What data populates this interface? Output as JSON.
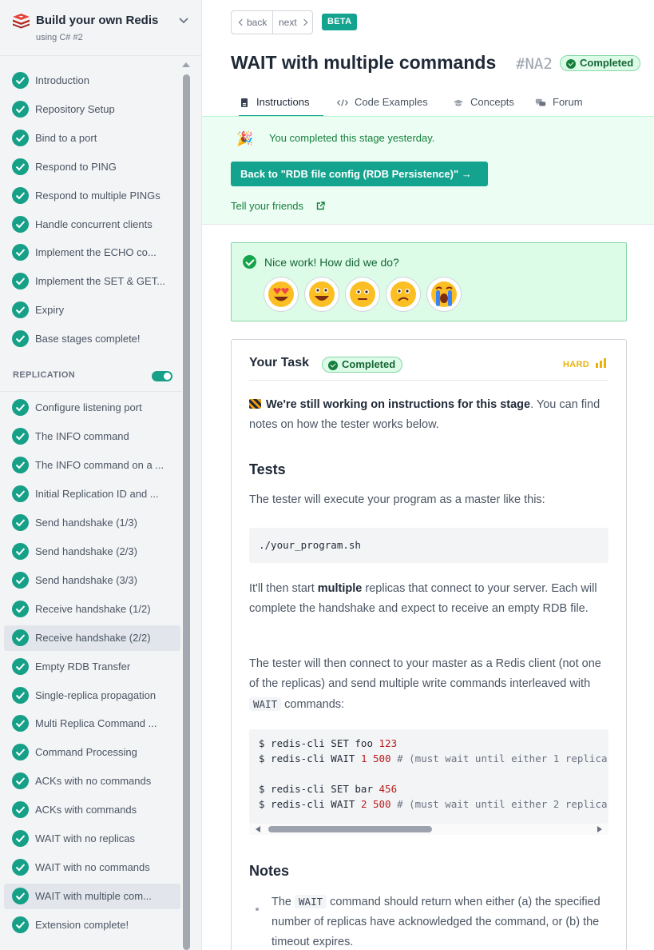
{
  "course": {
    "title": "Build your own Redis",
    "subtitle": "using C# #2"
  },
  "stages_base": [
    "Introduction",
    "Repository Setup",
    "Bind to a port",
    "Respond to PING",
    "Respond to multiple PINGs",
    "Handle concurrent clients",
    "Implement the ECHO co...",
    "Implement the SET & GET...",
    "Expiry",
    "Base stages complete!"
  ],
  "section_label": "REPLICATION",
  "stages_replication": [
    "Configure listening port",
    "The INFO command",
    "The INFO command on a ...",
    "Initial Replication ID and ...",
    "Send handshake (1/3)",
    "Send handshake (2/3)",
    "Send handshake (3/3)",
    "Receive handshake (1/2)",
    "Receive handshake (2/2)",
    "Empty RDB Transfer",
    "Single-replica propagation",
    "Multi Replica Command ...",
    "Command Processing",
    "ACKs with no commands",
    "ACKs with commands",
    "WAIT with no replicas",
    "WAIT with no commands",
    "WAIT with multiple com...",
    "Extension complete!"
  ],
  "nav": {
    "back": "back",
    "next": "next",
    "beta": "BETA"
  },
  "header": {
    "title": "WAIT with multiple commands",
    "code": "#NA2",
    "status": "Completed"
  },
  "tabs": {
    "instructions": "Instructions",
    "code_examples": "Code Examples",
    "concepts": "Concepts",
    "forum": "Forum"
  },
  "congrats": {
    "message": "You completed this stage yesterday.",
    "back_button": "Back to \"RDB file config (RDB Persistence)\" →",
    "tell_friends": "Tell your friends"
  },
  "feedback": {
    "prompt": "Nice work! How did we do?"
  },
  "task": {
    "heading": "Your Task",
    "status": "Completed",
    "difficulty": "HARD",
    "wip_bold": "We're still working on instructions for this stage",
    "wip_rest": ". You can find notes on how the tester works below.",
    "tests_heading": "Tests",
    "tests_p1": "The tester will execute your program as a master like this:",
    "cmd": "./your_program.sh",
    "p2_a": "It'll then start ",
    "p2_b": "multiple",
    "p2_c": " replicas that connect to your server. Each will complete the handshake and expect to receive an empty RDB file.",
    "p3_a": "The tester will then connect to your master as a Redis client (not one of the replicas) and send multiple write commands interleaved with ",
    "p3_code": "WAIT",
    "p3_c": " commands:",
    "code_lines": [
      {
        "prefix": "$ redis-cli SET foo ",
        "num": "123",
        "rest": ""
      },
      {
        "prefix": "$ redis-cli WAIT ",
        "num": "1 500",
        "rest": " # (must wait until either 1 replica"
      },
      {
        "prefix": "",
        "num": "",
        "rest": ""
      },
      {
        "prefix": "$ redis-cli SET bar ",
        "num": "456",
        "rest": ""
      },
      {
        "prefix": "$ redis-cli WAIT ",
        "num": "2 500",
        "rest": " # (must wait until either 2 replica"
      }
    ],
    "notes_heading": "Notes",
    "note1_a": "The ",
    "note1_code": "WAIT",
    "note1_b": " command should return when either (a) the specified number of replicas have acknowledged the command, or (b) the timeout expires."
  },
  "colors": {
    "accent": "#14a38f",
    "check": "#16a087",
    "success_bg": "#dcfce7",
    "success_text": "#166534",
    "hard": "#eab308"
  }
}
